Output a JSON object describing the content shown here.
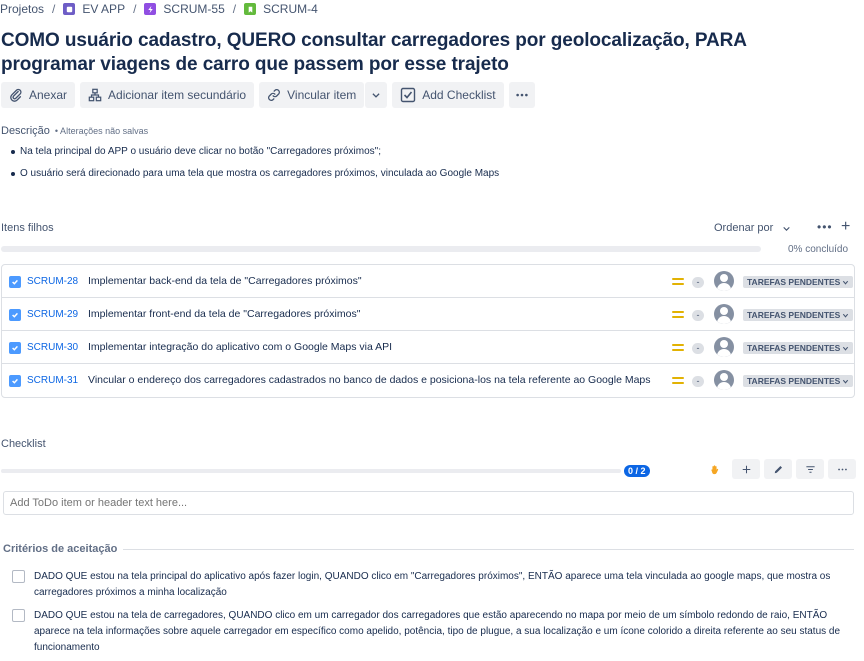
{
  "breadcrumb": {
    "root": "Projetos",
    "project": "EV APP",
    "epic": "SCRUM-55",
    "issue": "SCRUM-4"
  },
  "issue": {
    "title": "COMO usuário cadastro, QUERO consultar carregadores por geolocalização, PARA programar viagens de carro que passem por esse trajeto"
  },
  "toolbar": {
    "attach_label": "Anexar",
    "add_child_label": "Adicionar item secundário",
    "link_label": "Vincular item",
    "checklist_label": "Add Checklist"
  },
  "description": {
    "label": "Descrição",
    "unsaved_note": "• Alterações não salvas",
    "bullets": [
      "Na tela principal do APP o usuário deve clicar no botão \"Carregadores próximos\";",
      "O usuário será direcionado para uma tela que mostra os carregadores próximos, vinculada ao Google Maps"
    ]
  },
  "children": {
    "label": "Itens filhos",
    "order_by": "Ordenar por",
    "progress_fraction": 0,
    "progress_text": "0% concluído",
    "items": [
      {
        "key": "SCRUM-28",
        "summary": "Implementar back-end da tela de \"Carregadores próximos\"",
        "estimate": "-",
        "status": "TAREFAS PENDENTES"
      },
      {
        "key": "SCRUM-29",
        "summary": "Implementar front-end da tela de \"Carregadores próximos\"",
        "estimate": "-",
        "status": "TAREFAS PENDENTES"
      },
      {
        "key": "SCRUM-30",
        "summary": "Implementar integração do aplicativo com o Google Maps via API",
        "estimate": "-",
        "status": "TAREFAS PENDENTES"
      },
      {
        "key": "SCRUM-31",
        "summary": "Vincular o endereço dos carregadores cadastrados no banco de dados e posiciona-los na tela referente ao Google Maps",
        "estimate": "-",
        "status": "TAREFAS PENDENTES"
      }
    ]
  },
  "checklist": {
    "label": "Checklist",
    "progress_count": "0 / 2",
    "progress_fraction": 0,
    "add_placeholder": "Add ToDo item or header text here...",
    "section_header": "Critérios de aceitação",
    "items": [
      "DADO QUE estou na tela principal do aplicativo após fazer login, QUANDO clico em \"Carregadores próximos\", ENTÃO aparece uma tela vinculada ao google maps, que mostra os carregadores próximos a minha localização",
      "DADO QUE estou na tela de carregadores, QUANDO clico em um carregador dos carregadores que estão aparecendo no mapa por meio de um símbolo redondo de raio, ENTÃO aparece na tela informações sobre aquele carregador em específico como apelido, potência, tipo de plugue, a sua localização e um ícone colorido a direita referente ao seu status de funcionamento"
    ]
  },
  "colors": {
    "link": "#0c66e4",
    "priority_medium": "#e2b203",
    "project_icon": "#6e5dc6",
    "epic_icon": "#904ee2",
    "story_icon": "#63ba3c",
    "task_icon": "#4c9aff"
  }
}
